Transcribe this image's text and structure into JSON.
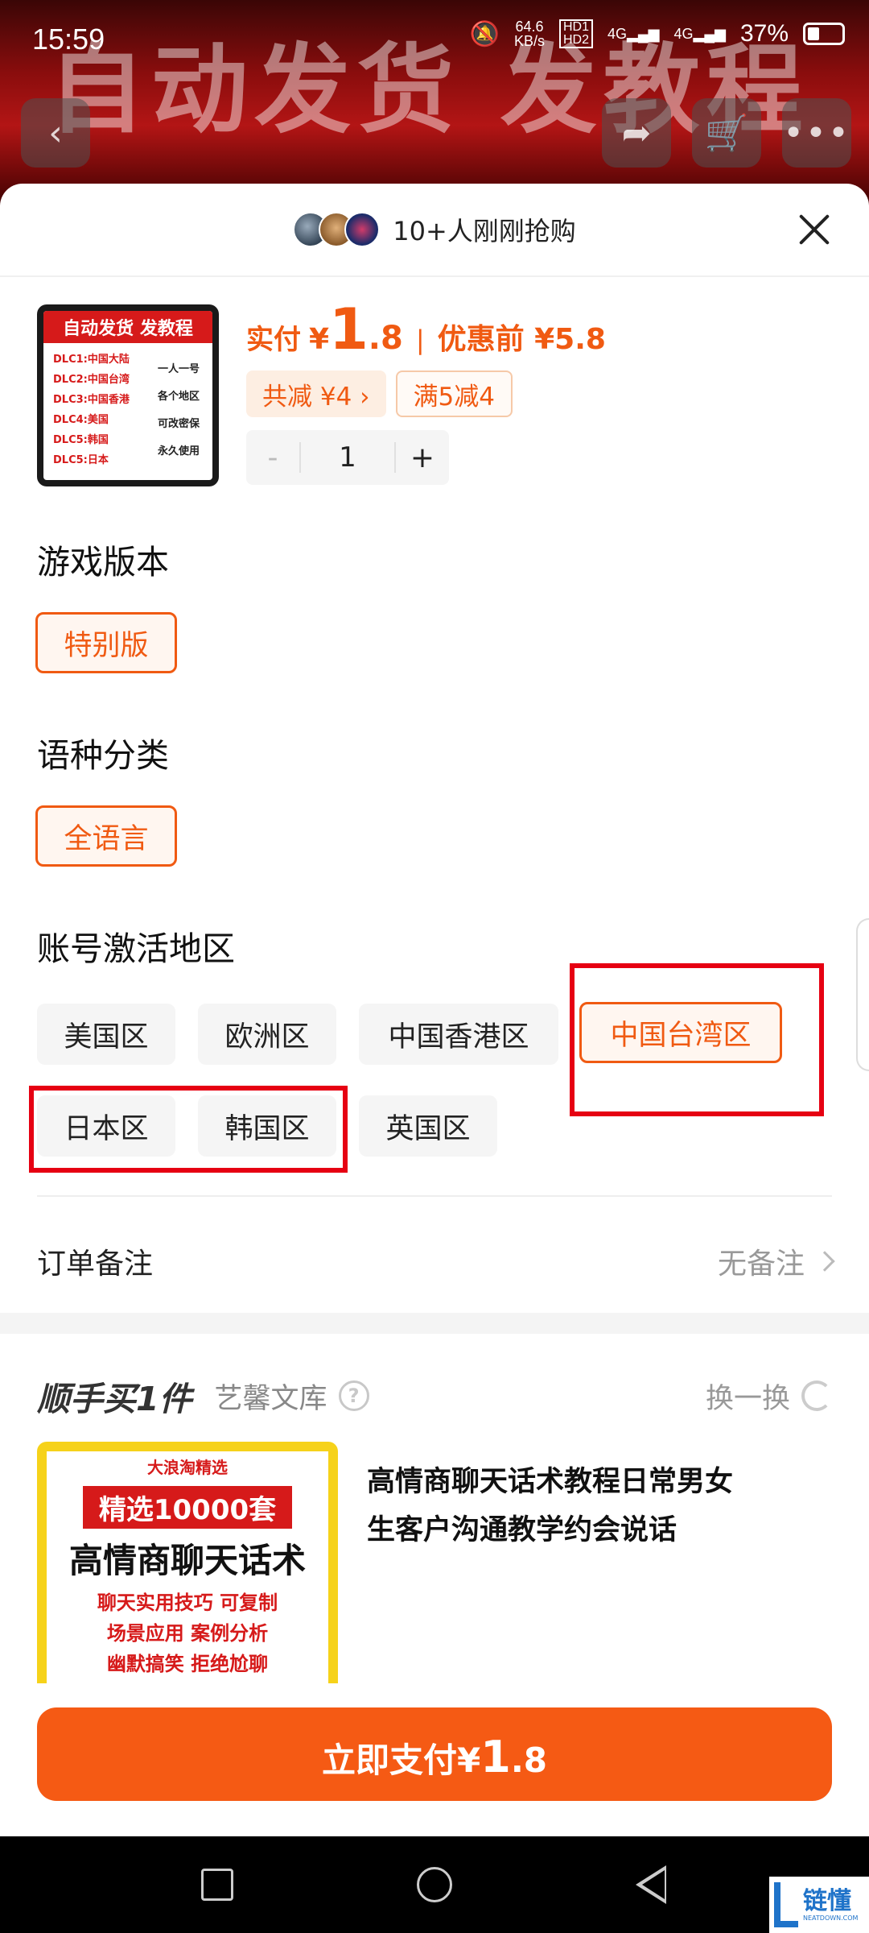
{
  "status_bar": {
    "time": "15:59",
    "speed_top": "64.6",
    "speed_unit": "KB/s",
    "hd1": "HD1",
    "hd2": "HD2",
    "net1": "4G",
    "net2": "4G",
    "battery": "37%"
  },
  "banner": {
    "text": "自动发货 发教程"
  },
  "sheet": {
    "buyers_text": "10+人刚刚抢购"
  },
  "product": {
    "thumb_title": "自动发货 发教程",
    "thumb_list": [
      "DLC1:中国大陆",
      "DLC2:中国台湾",
      "DLC3:中国香港",
      "DLC4:美国",
      "DLC5:韩国",
      "DLC5:日本"
    ],
    "thumb_side": [
      "一人一号",
      "各个地区",
      "可改密保",
      "永久使用"
    ],
    "price_label": "实付",
    "currency": "¥",
    "price_int": "1",
    "price_dec": ".8",
    "orig_label": "优惠前 ¥5.8",
    "discount_total": "共减 ¥4 ›",
    "discount_rule": "满5减4",
    "quantity": "1",
    "minus": "-",
    "plus": "+"
  },
  "sections": {
    "version_title": "游戏版本",
    "version_options": [
      "特别版"
    ],
    "language_title": "语种分类",
    "language_options": [
      "全语言"
    ],
    "region_title": "账号激活地区",
    "region_options": [
      "美国区",
      "欧洲区",
      "中国香港区",
      "中国台湾区",
      "日本区",
      "韩国区",
      "英国区"
    ],
    "region_selected": "中国台湾区"
  },
  "remark": {
    "label": "订单备注",
    "value": "无备注"
  },
  "addon": {
    "title": "顺手买1件",
    "shop": "艺馨文库",
    "swap": "换一换",
    "img_brand": "大浪淘精选",
    "img_badge": "精选10000套",
    "img_main": "高情商聊天话术",
    "img_lines": [
      "聊天实用技巧 可复制",
      "场景应用 案例分析",
      "幽默搞笑 拒绝尬聊"
    ],
    "name": "高情商聊天话术教程日常男女生客户沟通教学约会说话"
  },
  "pay": {
    "label": "立即支付",
    "currency": "¥",
    "amount_int": "1",
    "amount_dec": ".8"
  },
  "watermark": {
    "text": "链懂",
    "sub": "NEATDOWN.COM"
  },
  "colors": {
    "accent": "#f05a12",
    "pay_button": "#f55a14",
    "annotation": "#e60012"
  }
}
